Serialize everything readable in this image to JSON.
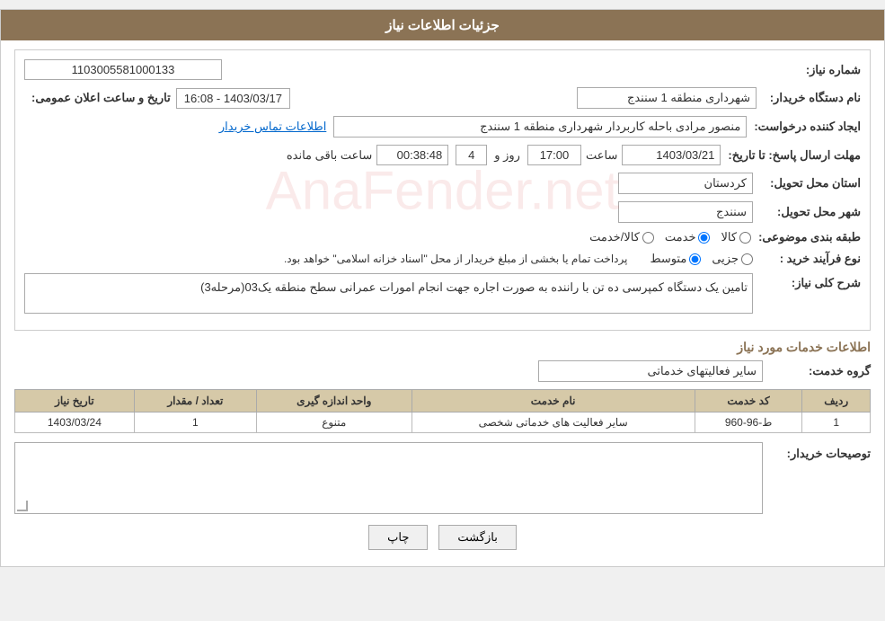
{
  "header": {
    "title": "جزئیات اطلاعات نیاز"
  },
  "fields": {
    "shimara_label": "شماره نیاز:",
    "shimara_value": "1103005581000133",
    "name_darkhast_label": "نام دستگاه خریدار:",
    "name_darkhast_value": "شهرداری منطقه 1 سنندج",
    "ijad_label": "ایجاد کننده درخواست:",
    "ijad_value": "منصور مرادی باحله کاربردار شهرداری منطقه 1 سنندج",
    "ijad_link": "اطلاعات تماس خریدار",
    "mohlat_label": "مهلت ارسال پاسخ: تا تاریخ:",
    "mohlat_date": "1403/03/21",
    "mohlat_saat_label": "ساعت",
    "mohlat_saat": "17:00",
    "mohlat_rooz_label": "روز و",
    "mohlat_rooz": "4",
    "mohlat_baqi_label": "ساعت باقی مانده",
    "mohlat_baqi": "00:38:48",
    "ostan_label": "استان محل تحویل:",
    "ostan_value": "کردستان",
    "shahr_label": "شهر محل تحویل:",
    "shahr_value": "سنندج",
    "tabaqe_label": "طبقه بندی موضوعی:",
    "tabaqe_options": [
      {
        "label": "کالا",
        "checked": false
      },
      {
        "label": "خدمت",
        "checked": true
      },
      {
        "label": "کالا/خدمت",
        "checked": false
      }
    ],
    "noe_label": "نوع فرآیند خرید :",
    "noe_options": [
      {
        "label": "جزیی",
        "checked": false
      },
      {
        "label": "متوسط",
        "checked": true
      }
    ],
    "noe_description": "پرداخت تمام یا بخشی از مبلغ خریدار از محل \"اسناد خزانه اسلامی\" خواهد بود.",
    "tarikh_label": "تاریخ و ساعت اعلان عمومی:",
    "tarikh_value": "1403/03/17 - 16:08",
    "sharh_label": "شرح کلی نیاز:",
    "sharh_value": "تامین یک دستگاه کمپرسی ده تن با راننده به صورت اجاره جهت انجام امورات عمرانی سطح منطقه یک03(مرحله3)",
    "khadamat_section": "اطلاعات خدمات مورد نیاز",
    "grohe_label": "گروه خدمت:",
    "grohe_value": "سایر فعالیتهای خدماتی",
    "table": {
      "headers": [
        "ردیف",
        "کد خدمت",
        "نام خدمت",
        "واحد اندازه گیری",
        "تعداد / مقدار",
        "تاریخ نیاز"
      ],
      "rows": [
        {
          "radif": "1",
          "code": "ط-96-960",
          "name": "سایر فعالیت های خدماتی شخصی",
          "vahed": "متنوع",
          "tedad": "1",
          "tarikh": "1403/03/24"
        }
      ]
    },
    "tosif_label": "توصیحات خریدار:"
  },
  "buttons": {
    "print": "چاپ",
    "back": "بازگشت"
  }
}
